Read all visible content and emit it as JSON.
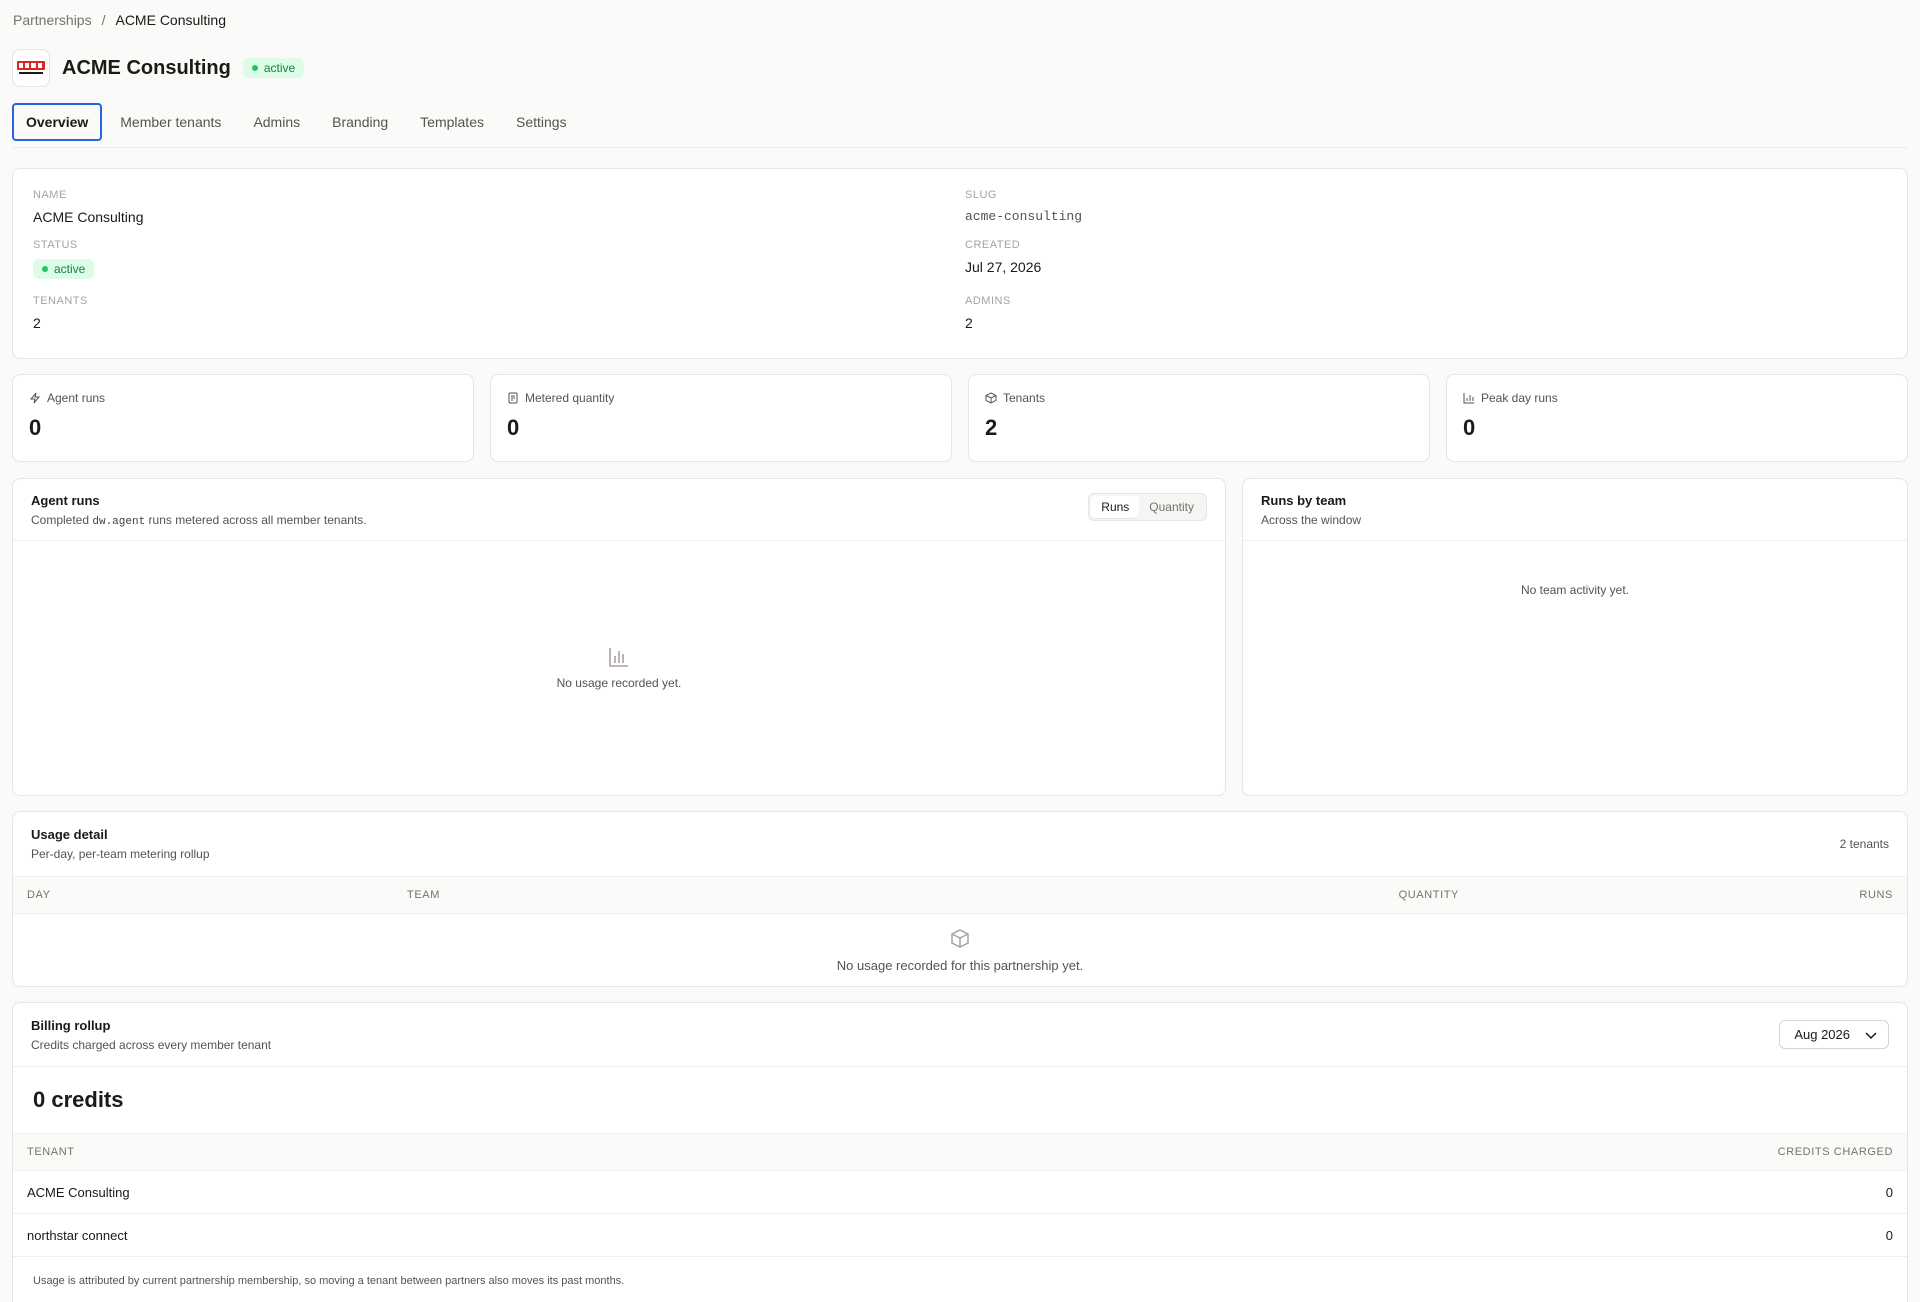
{
  "breadcrumb": {
    "parent": "Partnerships",
    "separator": "/",
    "current": "ACME Consulting"
  },
  "header": {
    "title": "ACME Consulting",
    "status": "active",
    "logo_icon": "acme-logo-icon"
  },
  "tabs": [
    {
      "label": "Overview",
      "active": true
    },
    {
      "label": "Member tenants"
    },
    {
      "label": "Admins"
    },
    {
      "label": "Branding"
    },
    {
      "label": "Templates"
    },
    {
      "label": "Settings"
    }
  ],
  "info": {
    "name_label": "Name",
    "name": "ACME Consulting",
    "slug_label": "Slug",
    "slug": "acme-consulting",
    "status_label": "Status",
    "status": "active",
    "created_label": "Created",
    "created": "Jul 27, 2026",
    "tenants_label": "Tenants",
    "tenants": "2",
    "admins_label": "Admins",
    "admins": "2"
  },
  "stats": [
    {
      "label": "Agent runs",
      "value": "0",
      "icon": "bolt-icon"
    },
    {
      "label": "Metered quantity",
      "value": "0",
      "icon": "meter-icon"
    },
    {
      "label": "Tenants",
      "value": "2",
      "icon": "box-icon"
    },
    {
      "label": "Peak day runs",
      "value": "0",
      "icon": "bar-chart-icon"
    }
  ],
  "agent_runs": {
    "title": "Agent runs",
    "sub_before": "Completed",
    "sub_code": "dw.agent",
    "sub_after": "runs metered across all member tenants.",
    "toggle_runs": "Runs",
    "toggle_quantity": "Quantity",
    "empty": "No usage recorded yet."
  },
  "runs_by_team": {
    "title": "Runs by team",
    "sub": "Across the window",
    "empty": "No team activity yet."
  },
  "usage": {
    "title": "Usage detail",
    "sub": "Per-day, per-team metering rollup",
    "count": "2 tenants",
    "columns": {
      "day": "Day",
      "team": "Team",
      "quantity": "Quantity",
      "runs": "Runs"
    },
    "empty": "No usage recorded for this partnership yet."
  },
  "billing": {
    "title": "Billing rollup",
    "sub": "Credits charged across every member tenant",
    "month": "Aug 2026",
    "total": "0 credits",
    "columns": {
      "tenant": "Tenant",
      "credits": "Credits charged"
    },
    "rows": [
      {
        "tenant": "ACME Consulting",
        "credits": "0"
      },
      {
        "tenant": "northstar connect",
        "credits": "0"
      }
    ],
    "footnote": "Usage is attributed by current partnership membership, so moving a tenant between partners also moves its past months."
  },
  "colors": {
    "accent": "#2563eb",
    "success": "#22c55e",
    "success_bg": "#dcfce7",
    "logo_red": "#dc2626"
  }
}
